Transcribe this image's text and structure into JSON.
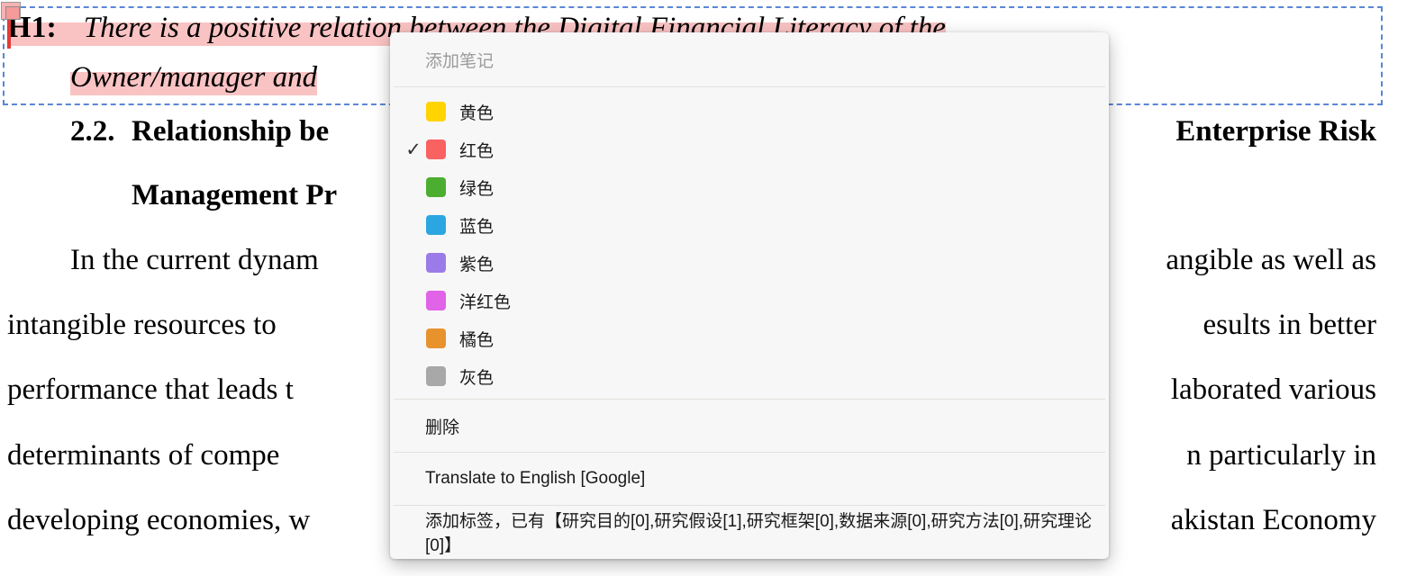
{
  "document": {
    "hypothesis": {
      "label": "H1",
      "colon": ":",
      "line1_text": "There   is   a   positive   relation   between   the   Digital   Financial   Literacy   of   the",
      "line2_text": "Owner/manager and"
    },
    "heading": {
      "number": "2.2.",
      "line1_left": "Relationship   be",
      "line1_right": "Enterprise   Risk",
      "line2": "Management Pr"
    },
    "paragraph_lines": [
      {
        "left": "In the current dynam",
        "right": "angible as well as",
        "indent": true
      },
      {
        "left": "intangible   resources   to",
        "right": "esults   in   better",
        "indent": false
      },
      {
        "left": "performance that leads t",
        "right": "laborated various",
        "indent": false
      },
      {
        "left": "determinants   of   compe",
        "right": "n   particularly   in",
        "indent": false
      },
      {
        "left": "developing economies, w",
        "right": "akistan Economy",
        "indent": false
      }
    ]
  },
  "context_menu": {
    "note_placeholder": "添加笔记",
    "colors": [
      {
        "label": "黄色",
        "hex": "#FFD400",
        "selected": false,
        "name": "yellow"
      },
      {
        "label": "红色",
        "hex": "#FA6161",
        "selected": true,
        "name": "red"
      },
      {
        "label": "绿色",
        "hex": "#4CAE30",
        "selected": false,
        "name": "green"
      },
      {
        "label": "蓝色",
        "hex": "#2BA6E0",
        "selected": false,
        "name": "blue"
      },
      {
        "label": "紫色",
        "hex": "#9B7BE8",
        "selected": false,
        "name": "purple"
      },
      {
        "label": "洋红色",
        "hex": "#E063E8",
        "selected": false,
        "name": "magenta"
      },
      {
        "label": "橘色",
        "hex": "#E8922E",
        "selected": false,
        "name": "orange"
      },
      {
        "label": "灰色",
        "hex": "#A8A8A8",
        "selected": false,
        "name": "gray"
      }
    ],
    "check_glyph": "✓",
    "delete_label": "删除",
    "translate_label": "Translate to English [Google]",
    "tags_label": "添加标签，已有【研究目的[0],研究假设[1],研究框架[0],数据来源[0],研究方法[0],研究理论[0]】"
  },
  "theme": {
    "highlight_pink": "#FAC3C3",
    "selection_blue": "#5B86D6",
    "marker_red": "#E23B3B",
    "menu_bg": "#F7F7F7",
    "placeholder_gray": "#9B9B9B"
  }
}
